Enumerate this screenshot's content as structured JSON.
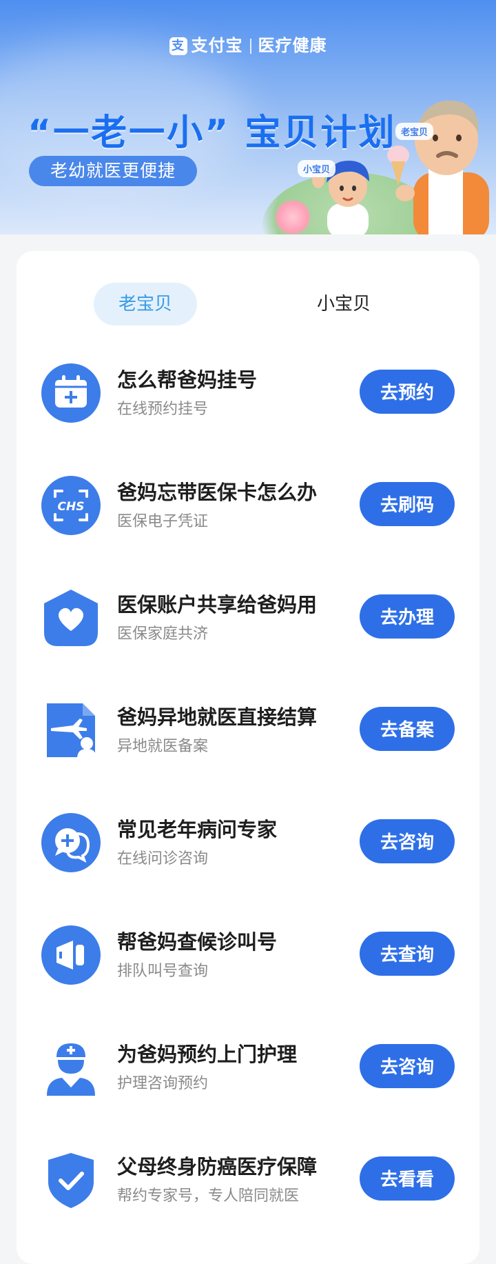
{
  "header": {
    "brand_name": "支付宝",
    "brand_section": "医疗健康",
    "plan_title": "“一老一小” 宝贝计划",
    "plan_subtitle": "老幼就医更便捷",
    "tag_old": "老宝贝",
    "tag_young": "小宝贝"
  },
  "tabs": [
    {
      "label": "老宝贝",
      "active": true
    },
    {
      "label": "小宝贝",
      "active": false
    }
  ],
  "items": [
    {
      "icon": "calendar-add-icon",
      "title": "怎么帮爸妈挂号",
      "subtitle": "在线预约挂号",
      "button": "去预约"
    },
    {
      "icon": "chs-scan-icon",
      "title": "爸妈忘带医保卡怎么办",
      "subtitle": "医保电子凭证",
      "button": "去刷码"
    },
    {
      "icon": "heart-shield-icon",
      "title": "医保账户共享给爸妈用",
      "subtitle": "医保家庭共济",
      "button": "去办理"
    },
    {
      "icon": "flight-document-icon",
      "title": "爸妈异地就医直接结算",
      "subtitle": "异地就医备案",
      "button": "去备案"
    },
    {
      "icon": "chat-plus-icon",
      "title": "常见老年病问专家",
      "subtitle": "在线问诊咨询",
      "button": "去咨询"
    },
    {
      "icon": "speaker-icon",
      "title": "帮爸妈查候诊叫号",
      "subtitle": "排队叫号查询",
      "button": "去查询"
    },
    {
      "icon": "nurse-icon",
      "title": "为爸妈预约上门护理",
      "subtitle": "护理咨询预约",
      "button": "去咨询"
    },
    {
      "icon": "shield-check-icon",
      "title": "父母终身防癌医疗保障",
      "subtitle": "帮约专家号，专人陪同就医",
      "button": "去看看"
    }
  ],
  "colors": {
    "accent": "#2e6fe8",
    "icon_blue": "#3d7de9",
    "tab_active_bg": "#e4f1fc",
    "tab_active_text": "#3a9be4"
  }
}
